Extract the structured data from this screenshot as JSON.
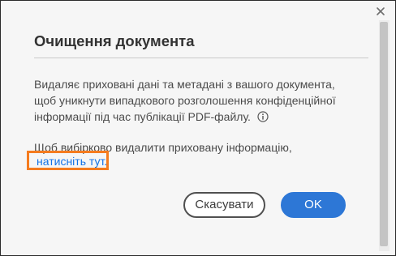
{
  "dialog": {
    "title": "Очищення документа",
    "description_lines": [
      "Видаляє приховані дані та метадані з вашого документа,",
      "щоб уникнути випадкового розголошення конфіденційної",
      "інформації під час публікації PDF-файлу."
    ],
    "selective_text": "Щоб вибірково видалити приховану інформацію,",
    "link_text": "натисніть тут.",
    "cancel_label": "Скасувати",
    "ok_label": "OK"
  },
  "icons": {
    "close": "close-icon",
    "info": "info-icon"
  },
  "colors": {
    "link": "#1473e6",
    "primary_button": "#2d77d6",
    "highlight_outline": "#f57c1f"
  }
}
